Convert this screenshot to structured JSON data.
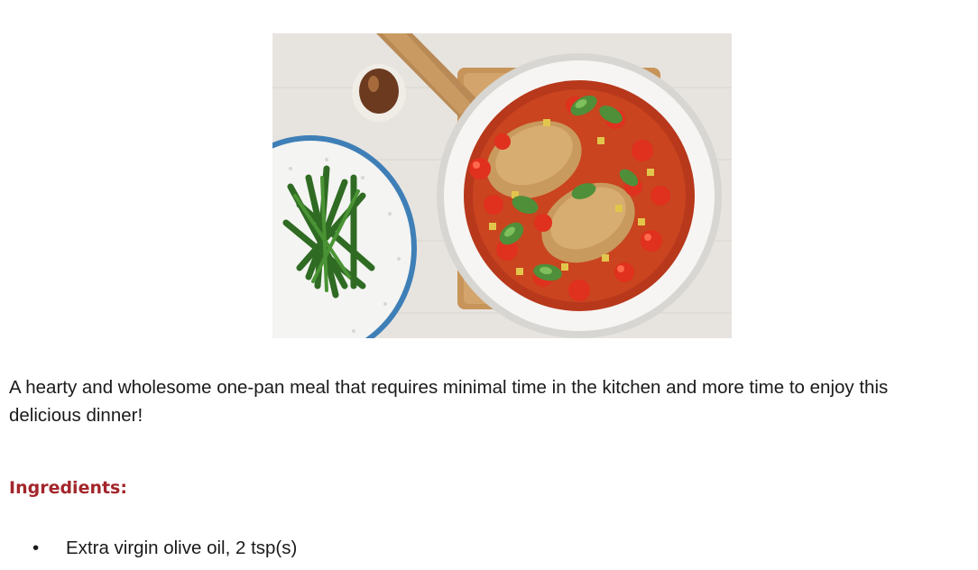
{
  "recipe": {
    "description": "A hearty and wholesome one-pan meal that requires minimal time in the kitchen and more time to enjoy this delicious dinner!",
    "ingredients_heading": "Ingredients:",
    "ingredients": [
      "Extra virgin olive oil, 2 tsp(s)"
    ],
    "image_icon": "photo-of-chicken-and-tomato-pan-meal"
  },
  "colors": {
    "heading": "#a3262b",
    "text": "#1a1a1a",
    "background": "#ffffff"
  }
}
